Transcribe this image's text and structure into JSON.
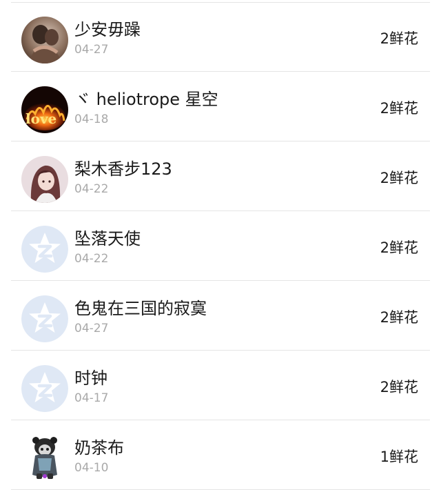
{
  "items": [
    {
      "name": "少安毋躁",
      "date": "04-27",
      "count": "2鲜花",
      "avatar": "photo-couple-icon"
    },
    {
      "name": "ヾ heliotrope 星空",
      "date": "04-18",
      "count": "2鲜花",
      "avatar": "fire-love-icon"
    },
    {
      "name": "梨木香步123",
      "date": "04-22",
      "count": "2鲜花",
      "avatar": "anime-girl-icon"
    },
    {
      "name": "坠落天使",
      "date": "04-22",
      "count": "2鲜花",
      "avatar": "default-star-avatar-icon"
    },
    {
      "name": "色鬼在三国的寂寞",
      "date": "04-27",
      "count": "2鲜花",
      "avatar": "default-star-avatar-icon"
    },
    {
      "name": "时钟",
      "date": "04-17",
      "count": "2鲜花",
      "avatar": "default-star-avatar-icon"
    },
    {
      "name": "奶茶布",
      "date": "04-10",
      "count": "1鲜花",
      "avatar": "panda-character-icon"
    }
  ],
  "colors": {
    "default_avatar_bg": "#dfe8f5",
    "default_avatar_star": "#ffffff",
    "divider": "#e4e4e4",
    "date_text": "#a9a9a9"
  }
}
